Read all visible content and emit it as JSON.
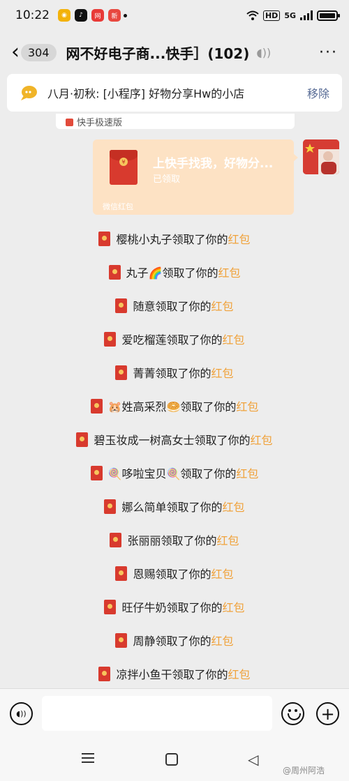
{
  "status_bar": {
    "time": "10:22",
    "app_icons": [
      {
        "icon": "weibo-icon",
        "color": "#f3b20a",
        "glyph": "◉"
      },
      {
        "icon": "tiktok-icon",
        "color": "#111111",
        "glyph": "♪"
      },
      {
        "icon": "netease-music-icon",
        "color": "#e83a37",
        "glyph": "网"
      },
      {
        "icon": "news-icon",
        "color": "#e8483f",
        "glyph": "新"
      }
    ],
    "indicators": [
      "wifi-icon",
      "HD",
      "5G",
      "signal-icon",
      "battery-icon"
    ]
  },
  "header": {
    "back_icon": "‹",
    "unread_count": "304",
    "title": "网不好电子商...快手］(102)",
    "voice_icon": "◖))",
    "more_icon": "···"
  },
  "pinned": {
    "text": "八月·初秋: [小程序] 好物分享Hw的小店",
    "remove_label": "移除"
  },
  "prev_card": {
    "label": "快手极速版"
  },
  "red_packet": {
    "title": "上快手找我，好物分...",
    "status": "已领取",
    "footer": "微信红包",
    "coin_glyph": "¥"
  },
  "system_messages": [
    {
      "name": "樱桃小丸子",
      "action": "领取了你的",
      "highlight": "红包"
    },
    {
      "name": "丸子🌈",
      "action": "领取了你的",
      "highlight": "红包"
    },
    {
      "name": "随意",
      "action": "领取了你的",
      "highlight": "红包"
    },
    {
      "name": "爱吃榴莲",
      "action": "领取了你的",
      "highlight": "红包"
    },
    {
      "name": "菁菁",
      "action": "领取了你的",
      "highlight": "红包"
    },
    {
      "name": "🐹姓高采烈🥯",
      "action": "领取了你的",
      "highlight": "红包"
    },
    {
      "name": "碧玉妆成一树高女士",
      "action": "领取了你的",
      "highlight": "红包"
    },
    {
      "name": "🍭哆啦宝贝🍭",
      "action": "领取了你的",
      "highlight": "红包"
    },
    {
      "name": "娜么简单",
      "action": "领取了你的",
      "highlight": "红包"
    },
    {
      "name": "张丽丽",
      "action": "领取了你的",
      "highlight": "红包"
    },
    {
      "name": "恩赐",
      "action": "领取了你的",
      "highlight": "红包"
    },
    {
      "name": "旺仔牛奶",
      "action": "领取了你的",
      "highlight": "红包"
    },
    {
      "name": "周静",
      "action": "领取了你的",
      "highlight": "红包"
    },
    {
      "name": "凉拌小鱼干",
      "action": "领取了你的",
      "highlight": "红包"
    }
  ],
  "input_bar": {
    "voice_icon": "◖))",
    "placeholder": "",
    "plus_icon": "+"
  },
  "watermark": "@周州阿浩",
  "colors": {
    "highlight": "#f0a23b",
    "red_packet_bg": "#fde2c4",
    "red": "#d83a2e",
    "link": "#576b95"
  }
}
